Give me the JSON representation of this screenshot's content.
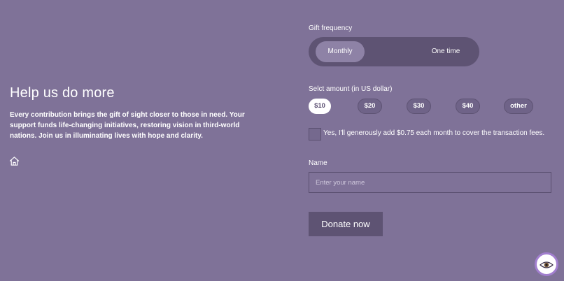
{
  "intro": {
    "heading": "Help us do more",
    "body": "Every contribution brings the gift of sight closer to those in need. Your support funds life-changing initiatives, restoring vision in third-world nations. Join us in illuminating lives with hope and clarity."
  },
  "icons": {
    "home": "home-icon",
    "widget": "eye-icon"
  },
  "form": {
    "frequency_label": "Gift frequency",
    "frequency_options": [
      "Monthly",
      "One time"
    ],
    "frequency_selected": "Monthly",
    "amount_label": "Selct amount (in US dollar)",
    "amounts": [
      "$10",
      "$20",
      "$30",
      "$40",
      "other"
    ],
    "amount_selected": "$10",
    "fee_checkbox_label": "Yes, I'll generously add $0.75 each month to cover the transaction fees.",
    "fee_checkbox_checked": false,
    "name_label": "Name",
    "name_placeholder": "Enter your name",
    "name_value": "",
    "donate_label": "Donate now"
  },
  "colors": {
    "background": "#7f7298",
    "dark_accent": "#5e5373",
    "selected_pill": "#ffffff",
    "widget_ring": "#a27fcf"
  }
}
